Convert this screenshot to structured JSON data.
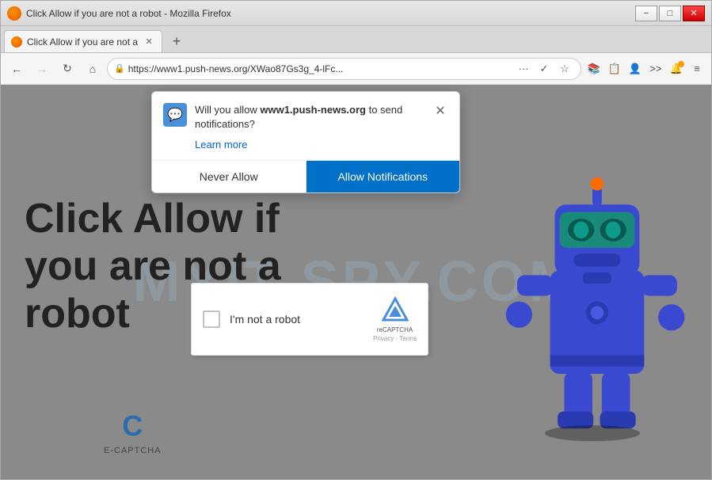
{
  "browser": {
    "title": "Click Allow if you are not a robot - Mozilla Firefox",
    "tab": {
      "title": "Click Allow if you are not a",
      "favicon": "firefox"
    },
    "url": "https://www1.push-news.org/XWao87Gs3g_4-lFc...",
    "controls": {
      "minimize": "−",
      "maximize": "□",
      "close": "✕"
    }
  },
  "notification": {
    "message_pre": "Will you allow ",
    "domain": "www1.push-news.org",
    "message_post": " to send notifications?",
    "learn_more": "Learn more",
    "never_allow": "Never Allow",
    "allow": "Allow Notifications",
    "icon": "💬",
    "close": "✕"
  },
  "page": {
    "main_text": "Click Allow if\nyou are not a\nrobot",
    "watermark": "MYIT SPY.COM",
    "ecaptcha_c": "C",
    "ecaptcha_label": "E-CAPTCHA"
  },
  "captcha": {
    "label": "I'm not a robot",
    "recaptcha_label": "reCAPTCHA",
    "links": "Privacy - Terms"
  },
  "nav": {
    "back": "←",
    "forward": "→",
    "reload": "↻",
    "home": "⌂",
    "more": "···",
    "bookmark": "☆",
    "menu": "≡"
  }
}
